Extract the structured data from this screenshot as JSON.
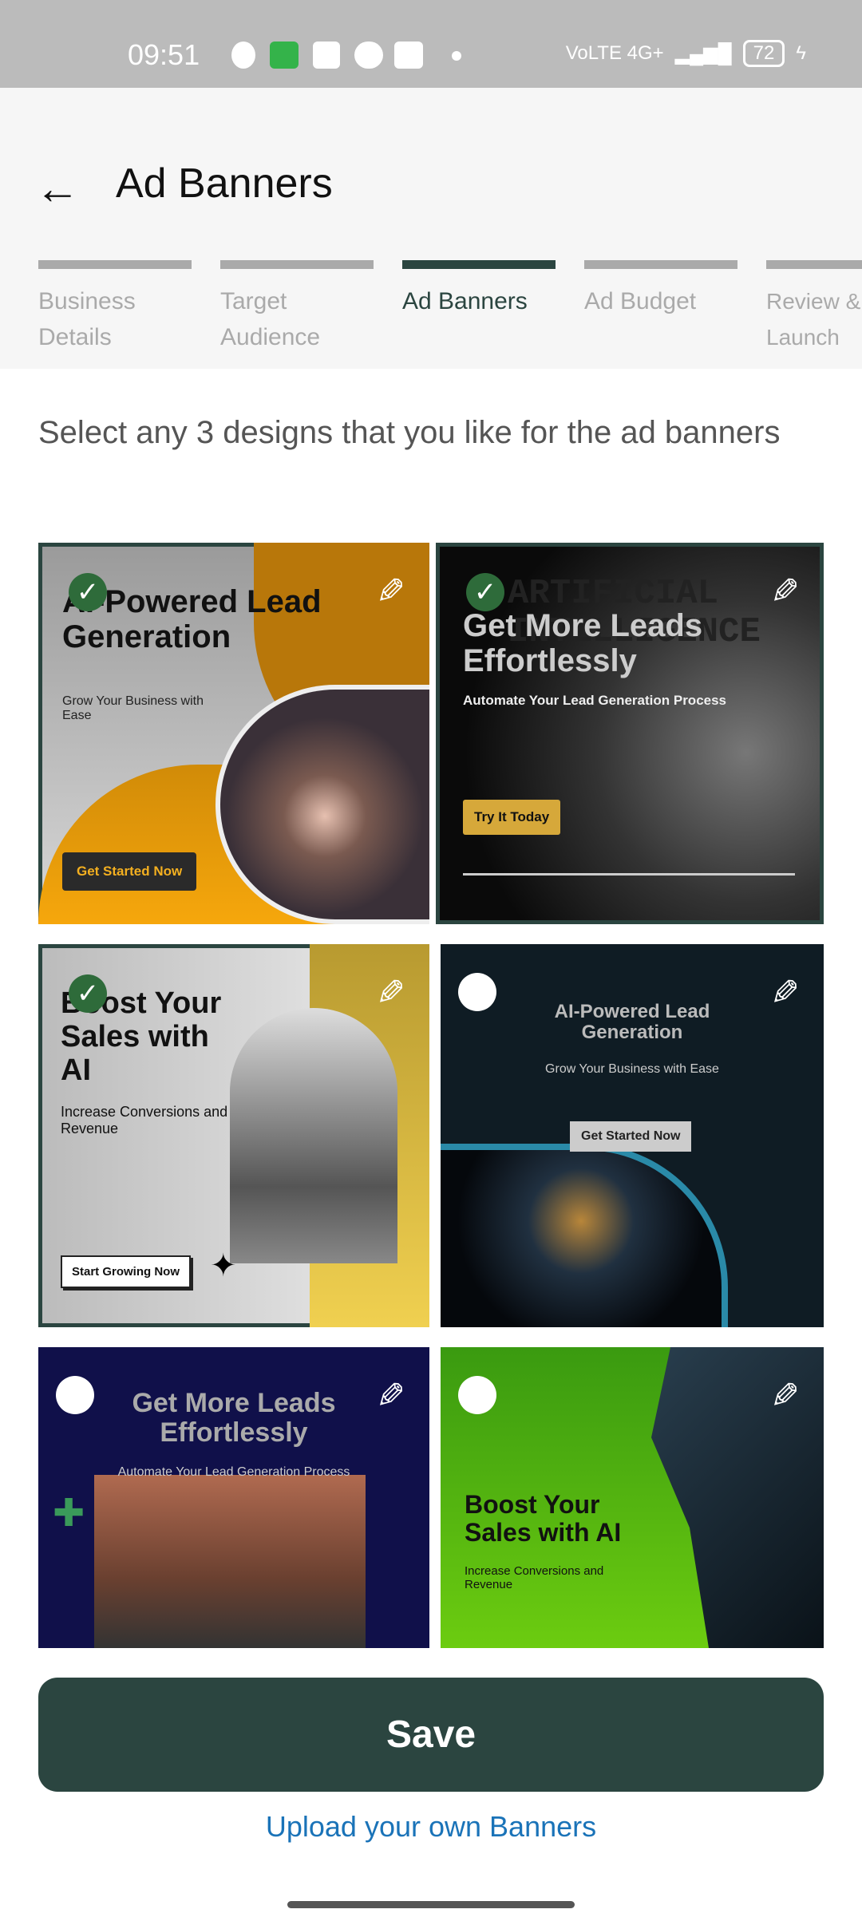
{
  "status_bar": {
    "time": "09:51",
    "network": "VoLTE 4G+",
    "battery": "72"
  },
  "header": {
    "title": "Ad Banners",
    "back_icon": "arrow-left-icon"
  },
  "steps": [
    {
      "label": "Business Details",
      "active": false
    },
    {
      "label": "Target Audience",
      "active": false
    },
    {
      "label": "Ad Banners",
      "active": true
    },
    {
      "label": "Ad Budget",
      "active": false
    },
    {
      "label": "Review & Launch",
      "active": false
    }
  ],
  "instruction": "Select any 3 designs that you like for the ad banners",
  "banners": [
    {
      "selected": true,
      "title": "AI-Powered Lead Generation",
      "subtitle": "Grow Your Business with Ease",
      "button": "Get Started Now"
    },
    {
      "selected": true,
      "title": "Get More Leads Effortlessly",
      "subtitle": "Automate Your Lead Generation Process",
      "button": "Try It Today",
      "background_text": "ARTIFICIAL INTELLIGENCE"
    },
    {
      "selected": true,
      "title": "Boost Your Sales with AI",
      "subtitle": "Increase Conversions and Revenue",
      "button": "Start Growing Now"
    },
    {
      "selected": false,
      "title": "AI-Powered Lead Generation",
      "subtitle": "Grow Your Business with Ease",
      "button": "Get Started Now"
    },
    {
      "selected": false,
      "title": "Get More Leads Effortlessly",
      "subtitle": "Automate Your Lead Generation Process"
    },
    {
      "selected": false,
      "title": "Boost Your Sales with AI",
      "subtitle": "Increase Conversions and Revenue"
    }
  ],
  "actions": {
    "save": "Save",
    "upload": "Upload your own Banners"
  },
  "colors": {
    "primary": "#2b4540",
    "link": "#1a73b8",
    "check": "#2e6b3a"
  }
}
